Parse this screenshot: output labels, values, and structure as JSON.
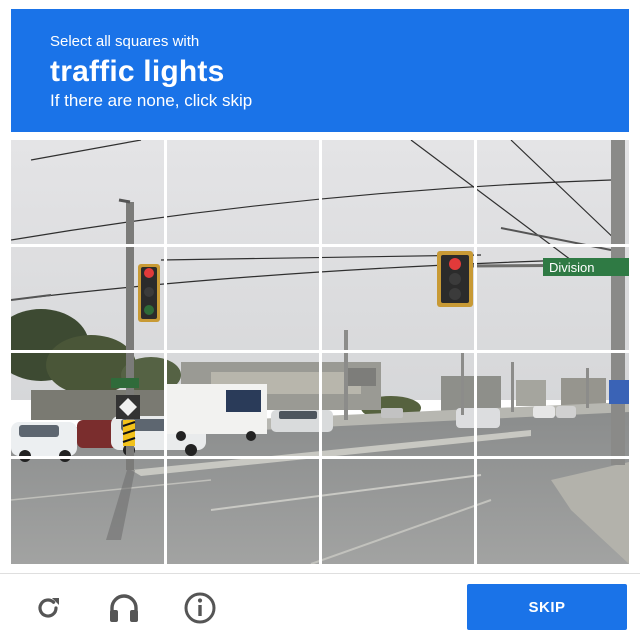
{
  "challenge": {
    "instruction": "Select all squares with",
    "target": "traffic lights",
    "hint": "If there are none, click skip"
  },
  "image": {
    "street_sign_text": "Division",
    "rows": 4,
    "cols": 4
  },
  "footer": {
    "reload_icon": "reload-icon",
    "audio_icon": "headphones-icon",
    "info_icon": "info-icon",
    "skip_label": "SKIP"
  },
  "colors": {
    "accent": "#1a73e8",
    "header_text": "#ffffff",
    "icon": "#555555"
  }
}
